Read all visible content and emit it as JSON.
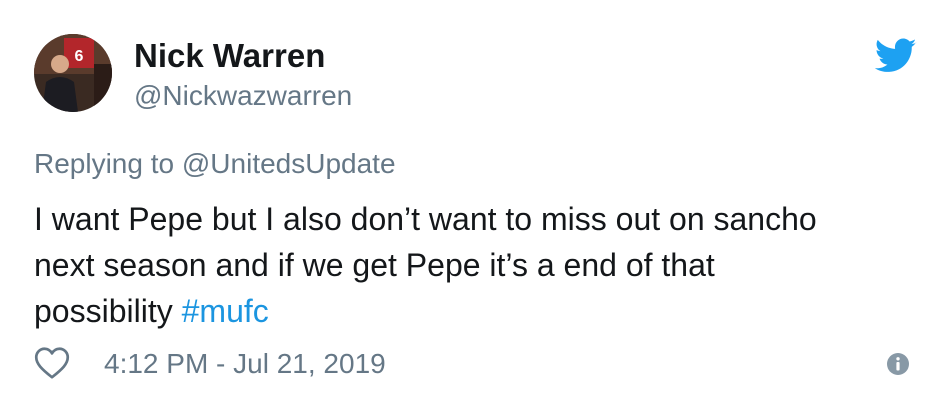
{
  "author": {
    "display_name": "Nick Warren",
    "handle": "@Nickwazwarren",
    "avatar_icon": "profile-photo-jersey-6"
  },
  "reply": {
    "prefix": "Replying to",
    "mention": "@UnitedsUpdate"
  },
  "tweet": {
    "line1": "I want Pepe but I also don’t want to miss out on sancho",
    "line2": "next season and if we get Pepe it’s a end of that",
    "line3_text": "possibility",
    "hashtag": "#mufc"
  },
  "footer": {
    "like_icon": "heart-icon",
    "timestamp": "4:12 PM - Jul 21, 2019",
    "info_icon": "info-icon"
  },
  "brand": {
    "logo_icon": "twitter-bird-icon",
    "accent_color": "#1da1f2",
    "hashtag_color": "#1b95e0",
    "muted_color": "#657786"
  }
}
